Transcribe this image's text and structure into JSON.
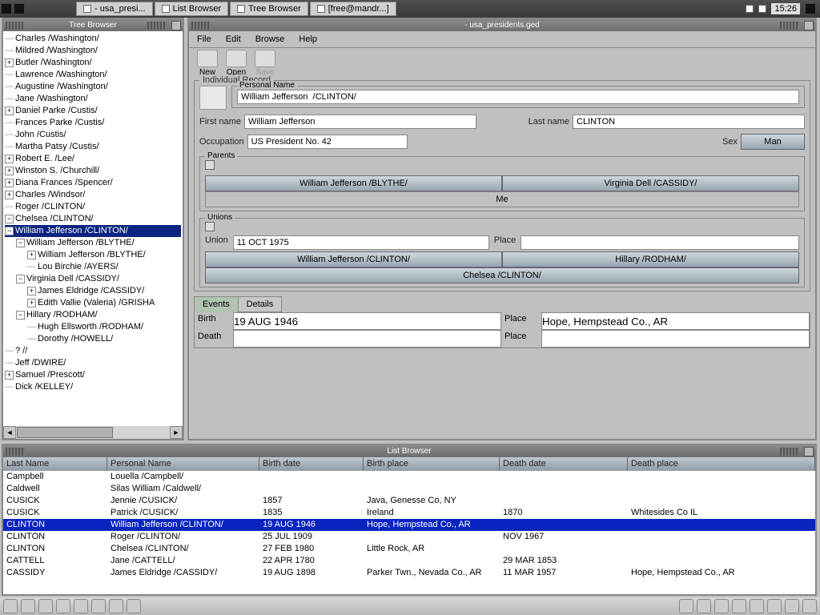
{
  "taskbar": {
    "items": [
      "- usa_presi...",
      "List Browser",
      "Tree Browser",
      "[free@mandr...]"
    ],
    "clock": "15:26"
  },
  "tree_window": {
    "title": "Tree Browser"
  },
  "tree": [
    {
      "d": 0,
      "e": "-",
      "t": "Charles  /Washington/"
    },
    {
      "d": 0,
      "e": "-",
      "t": "Mildred  /Washington/"
    },
    {
      "d": 0,
      "e": "+",
      "t": "Butler  /Washington/"
    },
    {
      "d": 0,
      "e": "-",
      "t": "Lawrence  /Washington/"
    },
    {
      "d": 0,
      "e": "-",
      "t": "Augustine  /Washington/"
    },
    {
      "d": 0,
      "e": "-",
      "t": "Jane  /Washington/"
    },
    {
      "d": 0,
      "e": "+",
      "t": "Daniel Parke  /Custis/"
    },
    {
      "d": 0,
      "e": "-",
      "t": "Frances Parke  /Custis/"
    },
    {
      "d": 0,
      "e": "-",
      "t": "John  /Custis/"
    },
    {
      "d": 0,
      "e": "-",
      "t": "Martha Patsy  /Custis/"
    },
    {
      "d": 0,
      "e": "+",
      "t": "Robert E.  /Lee/"
    },
    {
      "d": 0,
      "e": "+",
      "t": "Winston S.  /Churchill/"
    },
    {
      "d": 0,
      "e": "+",
      "t": "Diana Frances  /Spencer/"
    },
    {
      "d": 0,
      "e": "+",
      "t": "Charles  /Windsor/"
    },
    {
      "d": 0,
      "e": "-",
      "t": "Roger  /CLINTON/"
    },
    {
      "d": 0,
      "e": "−",
      "t": "Chelsea  /CLINTON/"
    },
    {
      "d": 0,
      "e": "−",
      "t": "William Jefferson  /CLINTON/",
      "sel": true
    },
    {
      "d": 1,
      "e": "−",
      "t": "William Jefferson  /BLYTHE/"
    },
    {
      "d": 2,
      "e": "+",
      "t": "William Jefferson  /BLYTHE/"
    },
    {
      "d": 2,
      "e": "-",
      "t": "Lou Birchie  /AYERS/"
    },
    {
      "d": 1,
      "e": "−",
      "t": "Virginia Dell  /CASSIDY/"
    },
    {
      "d": 2,
      "e": "+",
      "t": "James Eldridge  /CASSIDY/"
    },
    {
      "d": 2,
      "e": "+",
      "t": "Edith Vallie (Valeria)  /GRISHA"
    },
    {
      "d": 1,
      "e": "−",
      "t": "Hillary  /RODHAM/"
    },
    {
      "d": 2,
      "e": "-",
      "t": "Hugh Ellsworth  /RODHAM/"
    },
    {
      "d": 2,
      "e": "-",
      "t": "Dorothy  /HOWELL/"
    },
    {
      "d": 0,
      "e": "-",
      "t": "?  //"
    },
    {
      "d": 0,
      "e": "-",
      "t": "Jeff  /DWIRE/"
    },
    {
      "d": 0,
      "e": "+",
      "t": "Samuel  /Prescott/"
    },
    {
      "d": 0,
      "e": "-",
      "t": "Dick  /KELLEY/"
    }
  ],
  "main": {
    "title": "- usa_presidents.ged",
    "menu": [
      "File",
      "Edit",
      "Browse",
      "Help"
    ],
    "toolbar": [
      {
        "name": "new",
        "label": "New"
      },
      {
        "name": "open",
        "label": "Open"
      },
      {
        "name": "save",
        "label": "Save",
        "disabled": true
      }
    ],
    "record_legend": "Individual Record",
    "pname_legend": "Personal Name",
    "pname": "William Jefferson  /CLINTON/",
    "first_lbl": "First name",
    "first": "William Jefferson",
    "last_lbl": "Last name",
    "last": "CLINTON",
    "occ_lbl": "Occupation",
    "occ": "US President No. 42",
    "sex_lbl": "Sex",
    "sex": "Man",
    "parents_legend": "Parents",
    "father": "William Jefferson  /BLYTHE/",
    "mother": "Virginia Dell  /CASSIDY/",
    "me": "Me",
    "unions_legend": "Unions",
    "union_lbl": "Union",
    "union_date": "11 OCT 1975",
    "place_lbl": "Place",
    "union_place": "",
    "spouse1": "William Jefferson  /CLINTON/",
    "spouse2": "Hillary  /RODHAM/",
    "child": "Chelsea  /CLINTON/",
    "tabs": [
      "Events",
      "Details"
    ],
    "birth_lbl": "Birth",
    "birth": "19 AUG 1946",
    "birth_place": "Hope, Hempstead Co., AR",
    "death_lbl": "Death",
    "death": "",
    "death_place": ""
  },
  "list_window": {
    "title": "List Browser"
  },
  "list": {
    "headers": [
      "Last Name",
      "Personal Name",
      "Birth date",
      "Birth place",
      "Death date",
      "Death place"
    ],
    "rows": [
      [
        "Campbell",
        "Louella  /Campbell/",
        "",
        "",
        "",
        ""
      ],
      [
        "Caldwell",
        "Silas William  /Caldwell/",
        "",
        "",
        "",
        ""
      ],
      [
        "CUSICK",
        "Jennie  /CUSICK/",
        "1857",
        "Java, Genesse Co, NY",
        "",
        ""
      ],
      [
        "CUSICK",
        "Patrick  /CUSICK/",
        "1835",
        "Ireland",
        "1870",
        "Whitesides Co IL"
      ],
      [
        "CLINTON",
        "William Jefferson  /CLINTON/",
        "19 AUG 1946",
        "Hope, Hempstead Co., AR",
        "",
        ""
      ],
      [
        "CLINTON",
        "Roger  /CLINTON/",
        "25 JUL 1909",
        "",
        "NOV 1967",
        ""
      ],
      [
        "CLINTON",
        "Chelsea  /CLINTON/",
        "27 FEB 1980",
        "Little Rock, AR",
        "",
        ""
      ],
      [
        "CATTELL",
        "Jane  /CATTELL/",
        "22 APR 1780",
        "",
        "29 MAR 1853",
        ""
      ],
      [
        "CASSIDY",
        "James Eldridge  /CASSIDY/",
        "19 AUG 1898",
        "Parker Twn., Nevada Co., AR",
        "11 MAR 1957",
        "Hope, Hempstead Co., AR"
      ]
    ],
    "selected": 4
  }
}
